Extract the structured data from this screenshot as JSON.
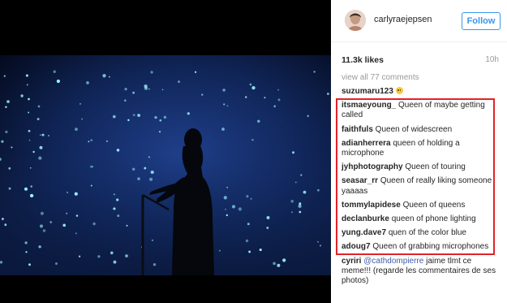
{
  "post": {
    "username": "carlyraejepsen",
    "follow_label": "Follow",
    "likes": "11.3k likes",
    "time": "10h",
    "view_all": "view all 77 comments"
  },
  "comments": [
    {
      "user": "suzumaru123",
      "text": "",
      "emoji": true
    },
    {
      "user": "itsmaeyoung_",
      "text": "Queen of maybe getting called"
    },
    {
      "user": "faithfuls",
      "text": "Queen of widescreen"
    },
    {
      "user": "adianherrera",
      "text": "queen of holding a microphone"
    },
    {
      "user": "jyhphotography",
      "text": "Queen of touring"
    },
    {
      "user": "seasar_rr",
      "text": "Queen of really liking someone yaaaas"
    },
    {
      "user": "tommylapidese",
      "text": "Queen of queens"
    },
    {
      "user": "declanburke",
      "text": "queen of phone lighting"
    },
    {
      "user": "yung.dave7",
      "text": "quen of the color blue"
    },
    {
      "user": "adoug7",
      "text": "Queen of grabbing microphones"
    },
    {
      "user": "cyriri",
      "mention": "@cathdompierre",
      "text": "jaime tlmt ce meme!!! (regarde les commentaires de ses photos)"
    }
  ],
  "colors": {
    "follow_blue": "#3897f0",
    "highlight_red": "#e0242a",
    "mention_blue": "#3e5ea8"
  }
}
